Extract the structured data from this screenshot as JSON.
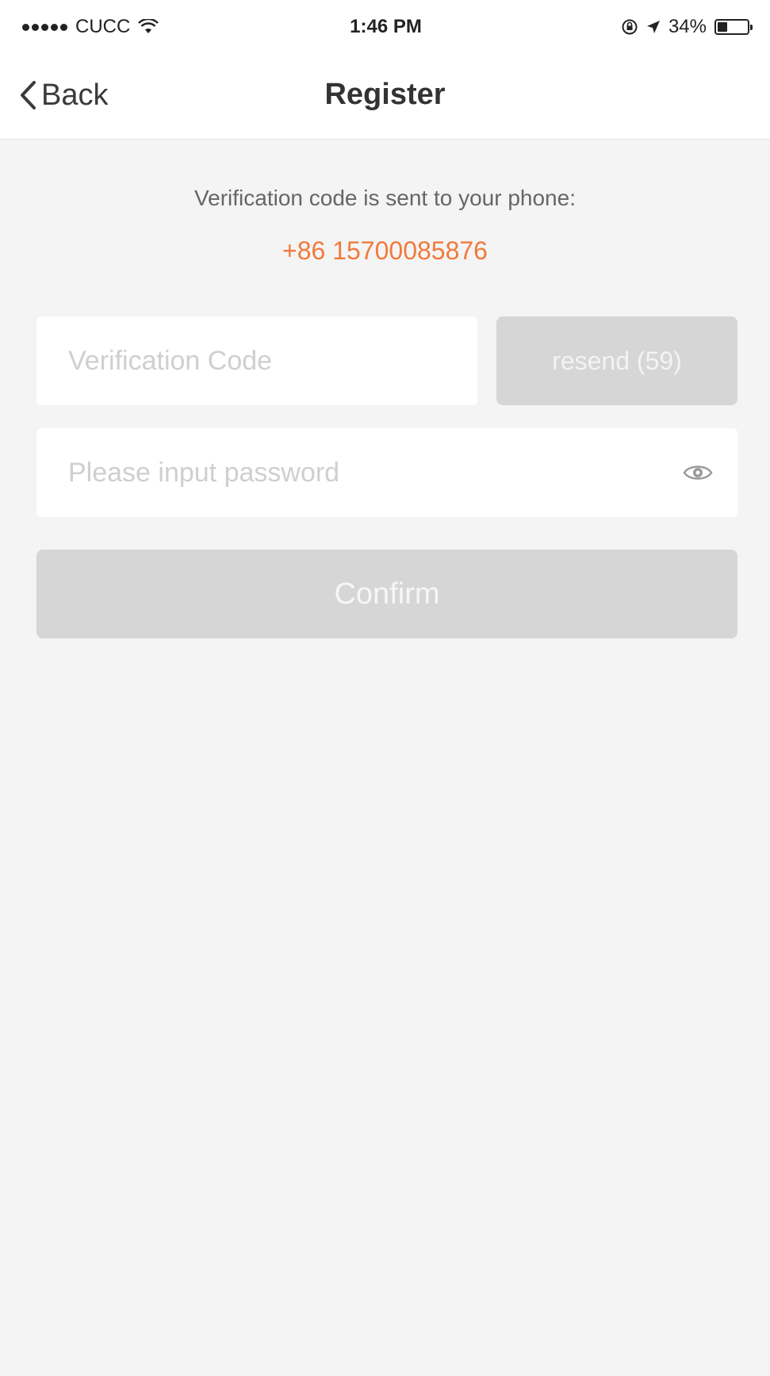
{
  "status_bar": {
    "carrier": "CUCC",
    "time": "1:46 PM",
    "battery_text": "34%",
    "battery_level": 0.34,
    "icons": [
      "signal-dots-icon",
      "wifi-icon",
      "lock-rotation-icon",
      "location-arrow-icon",
      "battery-icon"
    ]
  },
  "nav": {
    "back_label": "Back",
    "title": "Register"
  },
  "verification": {
    "message": "Verification code is sent to your phone:",
    "phone": "+86 15700085876",
    "code_placeholder": "Verification Code",
    "resend_label": "resend (59)"
  },
  "password": {
    "placeholder": "Please input password",
    "icon": "eye-icon"
  },
  "confirm_label": "Confirm",
  "colors": {
    "accent": "#f07a3c",
    "background": "#f4f4f4",
    "disabled_button": "#d6d6d6"
  }
}
